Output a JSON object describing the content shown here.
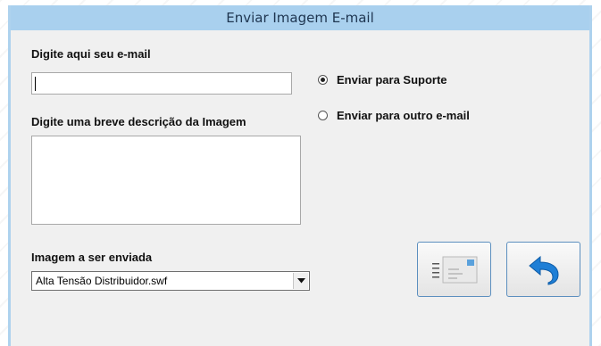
{
  "window": {
    "title": "Enviar Imagem E-mail"
  },
  "email": {
    "label": "Digite aqui seu e-mail",
    "value": ""
  },
  "description": {
    "label": "Digite uma breve descrição da Imagem",
    "value": ""
  },
  "image_select": {
    "label": "Imagem a ser enviada",
    "selected": "Alta Tensão Distribuidor.swf"
  },
  "radios": {
    "support": {
      "label": "Enviar para Suporte",
      "checked": true
    },
    "other": {
      "label": "Enviar para outro e-mail",
      "checked": false
    }
  },
  "buttons": {
    "send": {
      "icon": "mail-envelope-icon"
    },
    "back": {
      "icon": "return-arrow-icon"
    }
  },
  "colors": {
    "titlebar": "#a9d0ee",
    "frame": "#aed2ee",
    "button_border": "#5c8fbf",
    "arrow": "#1f7fd6"
  }
}
